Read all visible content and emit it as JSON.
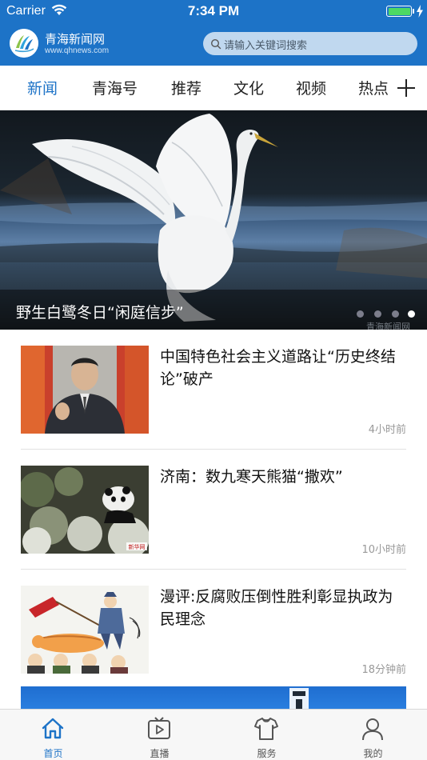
{
  "status_bar": {
    "carrier": "Carrier",
    "time": "7:34 PM"
  },
  "header": {
    "brand_name": "青海新闻网",
    "brand_url": "www.qhnews.com",
    "search_placeholder": "请输入关键词搜索",
    "accent_color": "#1d73c7"
  },
  "tabs": [
    {
      "label": "新闻",
      "active": true
    },
    {
      "label": "青海号"
    },
    {
      "label": "推荐"
    },
    {
      "label": "文化"
    },
    {
      "label": "视频"
    },
    {
      "label": "热点"
    }
  ],
  "banner": {
    "caption": "野生白鹭冬日“闲庭信步”",
    "watermark": "青海新闻网",
    "slide_count": 4,
    "active_slide": 4
  },
  "news": [
    {
      "title": "中国特色社会主义道路让“历史终结论”破产",
      "time": "4小时前"
    },
    {
      "title": "济南：数九寒天熊猫“撒欢”",
      "time": "10小时前",
      "thumb_watermark": "新华网"
    },
    {
      "title": "漫评:反腐败压倒性胜利彰显执政为民理念",
      "time": "18分钟前"
    }
  ],
  "tabbar": [
    {
      "label": "首页",
      "icon": "home-icon",
      "active": true
    },
    {
      "label": "直播",
      "icon": "play-icon"
    },
    {
      "label": "服务",
      "icon": "shirt-icon"
    },
    {
      "label": "我的",
      "icon": "user-icon"
    }
  ]
}
